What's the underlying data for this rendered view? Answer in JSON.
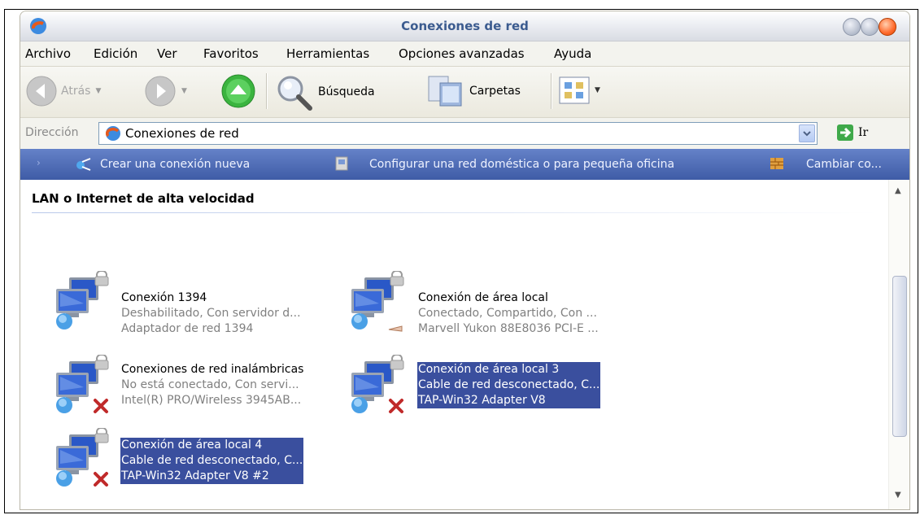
{
  "window": {
    "title": "Conexiones de red"
  },
  "menu": [
    "Archivo",
    "Edición",
    "Ver",
    "Favoritos",
    "Herramientas",
    "Opciones avanzadas",
    "Ayuda"
  ],
  "toolbar": {
    "back_label": "Atrás",
    "search_label": "Búsqueda",
    "folders_label": "Carpetas"
  },
  "address": {
    "label": "Dirección",
    "value": "Conexiones de red",
    "go_label": "Ir"
  },
  "tasks": [
    "Crear una conexión nueva",
    "Configurar una red doméstica o para pequeña oficina",
    "Cambiar co..."
  ],
  "group": {
    "title": "LAN o Internet de alta velocidad"
  },
  "items": [
    {
      "name": "Conexión 1394",
      "status": "Deshabilitado, Con servidor d...",
      "device": "Adaptador de red 1394"
    },
    {
      "name": "Conexión de área local",
      "status": "Conectado, Compartido, Con ...",
      "device": "Marvell Yukon 88E8036 PCI-E ..."
    },
    {
      "name": "Conexiones de red inalámbricas",
      "status": "No está conectado, Con servi...",
      "device": "Intel(R) PRO/Wireless 3945AB..."
    },
    {
      "name": "Conexión de área local 3",
      "status": "Cable de red desconectado, C...",
      "device": "TAP-Win32 Adapter V8"
    },
    {
      "name": "Conexión de área local 4",
      "status": "Cable de red desconectado, C...",
      "device": "TAP-Win32 Adapter V8 #2"
    }
  ],
  "colors": {
    "selection": "#3a4f9e",
    "taskbar": "#4a67b0",
    "title_text": "#3b5b8f"
  }
}
